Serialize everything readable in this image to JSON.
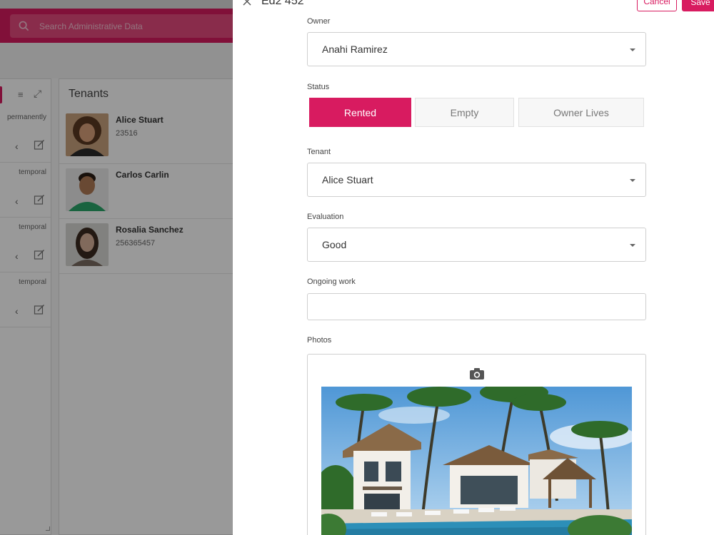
{
  "background": {
    "search_placeholder": "Search Administrative Data",
    "left_panel": {
      "rows": [
        {
          "text": "permanently"
        },
        {
          "text": "temporal"
        },
        {
          "text": "temporal"
        },
        {
          "text": "temporal"
        }
      ]
    },
    "tenants_panel": {
      "title": "Tenants",
      "rows": [
        {
          "name": "Alice Stuart",
          "id": "23516"
        },
        {
          "name": "Carlos Carlin",
          "id": ""
        },
        {
          "name": "Rosalia Sanchez",
          "id": "256365457"
        }
      ]
    }
  },
  "drawer": {
    "title": "Ed2 452",
    "cancel_label": "Cancel",
    "save_label": "Save",
    "owner": {
      "label": "Owner",
      "value": "Anahi Ramirez"
    },
    "status": {
      "label": "Status",
      "options": [
        "Rented",
        "Empty",
        "Owner Lives"
      ],
      "selected": "Rented"
    },
    "tenant": {
      "label": "Tenant",
      "value": "Alice Stuart"
    },
    "evaluation": {
      "label": "Evaluation",
      "value": "Good"
    },
    "ongoing_work": {
      "label": "Ongoing work",
      "value": ""
    },
    "photos": {
      "label": "Photos"
    }
  },
  "colors": {
    "accent": "#d81b60"
  }
}
